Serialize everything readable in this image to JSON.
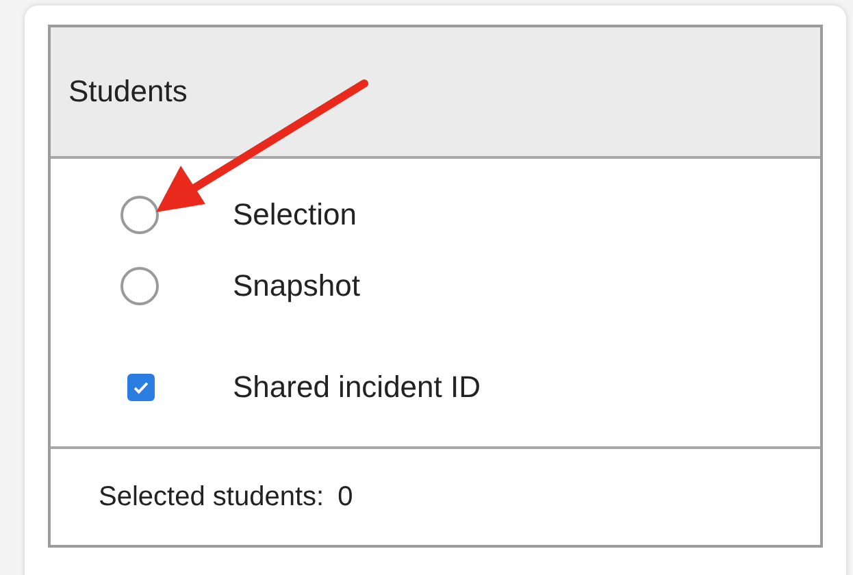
{
  "panel": {
    "title": "Students"
  },
  "options": [
    {
      "kind": "radio",
      "label": "Selection",
      "selected": false
    },
    {
      "kind": "radio",
      "label": "Snapshot",
      "selected": false
    },
    {
      "kind": "checkbox",
      "label": "Shared incident ID",
      "checked": true
    }
  ],
  "footer": {
    "label": "Selected students:",
    "count": "0"
  }
}
